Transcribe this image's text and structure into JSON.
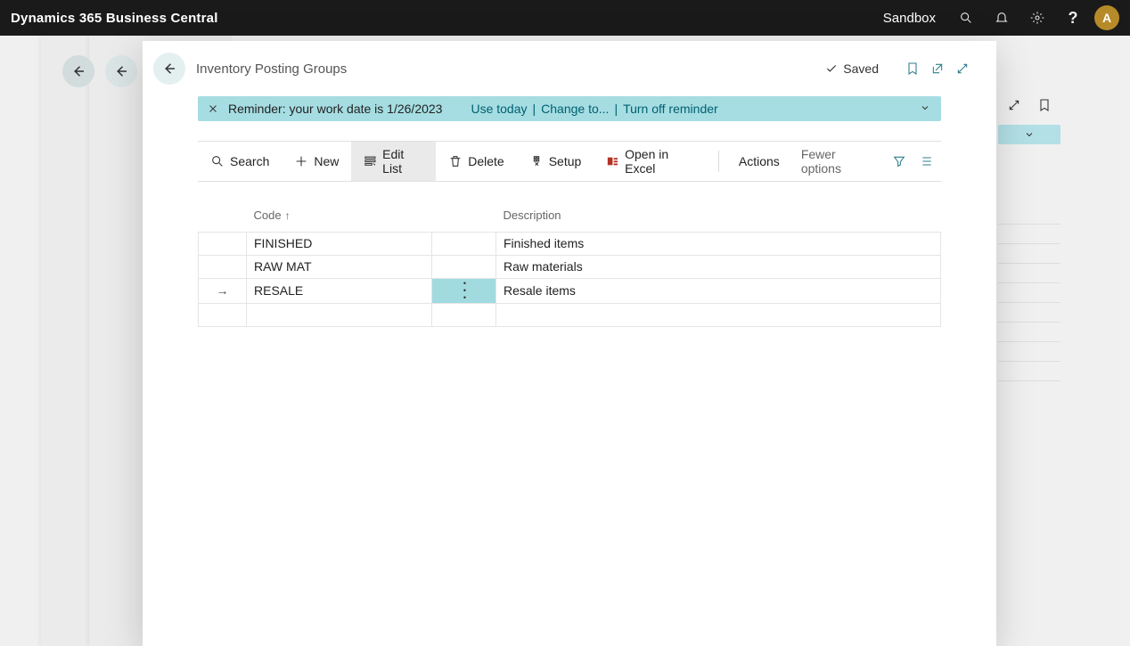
{
  "app": {
    "title": "Dynamics 365 Business Central",
    "environment": "Sandbox",
    "avatar_initial": "A"
  },
  "page": {
    "title": "Inventory Posting Groups",
    "saved_label": "Saved"
  },
  "reminder": {
    "text": "Reminder: your work date is 1/26/2023",
    "use_today": "Use today",
    "change_to": "Change to...",
    "turn_off": "Turn off reminder"
  },
  "toolbar": {
    "search": "Search",
    "new": "New",
    "edit_list": "Edit List",
    "delete": "Delete",
    "setup": "Setup",
    "open_in_excel": "Open in Excel",
    "actions": "Actions",
    "fewer_options": "Fewer options"
  },
  "columns": {
    "code": "Code",
    "description": "Description"
  },
  "rows": [
    {
      "code": "FINISHED",
      "description": "Finished items",
      "selected": false
    },
    {
      "code": "RAW MAT",
      "description": "Raw materials",
      "selected": false
    },
    {
      "code": "RESALE",
      "description": "Resale items",
      "selected": true
    }
  ]
}
